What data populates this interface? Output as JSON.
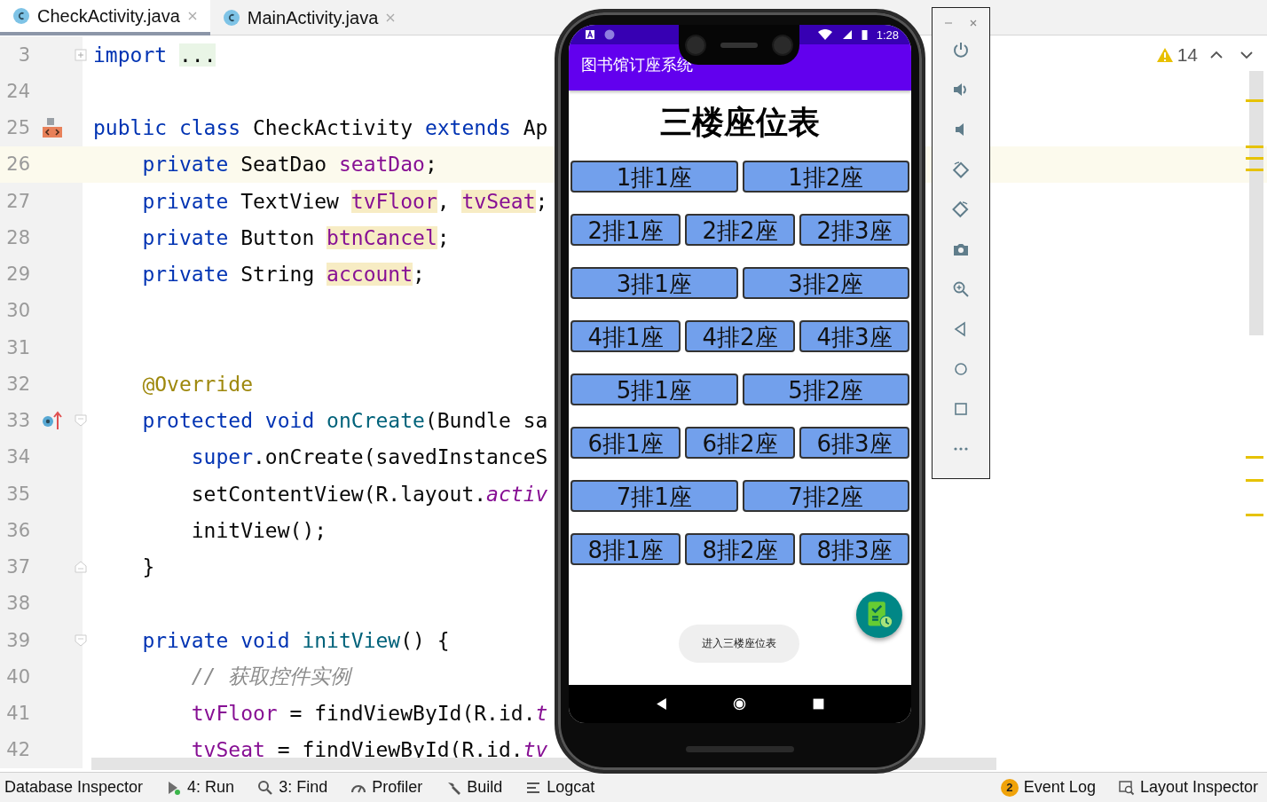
{
  "tabs": [
    {
      "label": "CheckActivity.java",
      "selected": true
    },
    {
      "label": "MainActivity.java",
      "selected": false
    }
  ],
  "editor": {
    "warning_count": "14",
    "lines": [
      {
        "number": "3",
        "current": false,
        "tokens": [
          {
            "text": "import ",
            "kind": "kw"
          },
          {
            "text": "...",
            "kind": "folded"
          }
        ]
      },
      {
        "number": "24",
        "current": false
      },
      {
        "number": "25",
        "current": false,
        "tokens": [
          {
            "text": "public class",
            "kind": "kw"
          },
          {
            "text": " CheckActivity ",
            "kind": "plain"
          },
          {
            "text": "extends",
            "kind": "kw"
          },
          {
            "text": " Ap",
            "kind": "plain"
          }
        ]
      },
      {
        "number": "26",
        "current": true,
        "tokens": [
          {
            "text": "    private",
            "kind": "kw"
          },
          {
            "text": " SeatDao ",
            "kind": "plain"
          },
          {
            "text": "seatDao",
            "kind": "field"
          },
          {
            "text": ";",
            "kind": "plain"
          }
        ]
      },
      {
        "number": "27",
        "current": false,
        "tokens": [
          {
            "text": "    private",
            "kind": "kw"
          },
          {
            "text": " TextView ",
            "kind": "plain"
          },
          {
            "text": "tvFloor",
            "kind": "marked_field"
          },
          {
            "text": ", ",
            "kind": "plain"
          },
          {
            "text": "tvSeat",
            "kind": "marked_field"
          },
          {
            "text": ";",
            "kind": "plain"
          }
        ]
      },
      {
        "number": "28",
        "current": false,
        "tokens": [
          {
            "text": "    private",
            "kind": "kw"
          },
          {
            "text": " Button ",
            "kind": "plain"
          },
          {
            "text": "btnCancel",
            "kind": "marked_field"
          },
          {
            "text": ";",
            "kind": "plain"
          }
        ]
      },
      {
        "number": "29",
        "current": false,
        "tokens": [
          {
            "text": "    private",
            "kind": "kw"
          },
          {
            "text": " String ",
            "kind": "plain"
          },
          {
            "text": "account",
            "kind": "marked_field"
          },
          {
            "text": ";",
            "kind": "plain"
          }
        ]
      },
      {
        "number": "30",
        "current": false
      },
      {
        "number": "31",
        "current": false
      },
      {
        "number": "32",
        "current": false,
        "tokens": [
          {
            "text": "    @Override",
            "kind": "annotation"
          }
        ]
      },
      {
        "number": "33",
        "current": false,
        "tokens": [
          {
            "text": "    protected void",
            "kind": "kw"
          },
          {
            "text": " onCreate",
            "kind": "method"
          },
          {
            "text": "(Bundle sa",
            "kind": "plain"
          }
        ]
      },
      {
        "number": "34",
        "current": false,
        "tokens": [
          {
            "text": "        super",
            "kind": "kw"
          },
          {
            "text": ".onCreate(savedInstanceS",
            "kind": "plain"
          }
        ]
      },
      {
        "number": "35",
        "current": false,
        "tokens": [
          {
            "text": "        setContentView(R.layout.",
            "kind": "plain"
          },
          {
            "text": "activ",
            "kind": "static"
          }
        ]
      },
      {
        "number": "36",
        "current": false,
        "tokens": [
          {
            "text": "        initView();",
            "kind": "plain"
          }
        ]
      },
      {
        "number": "37",
        "current": false,
        "tokens": [
          {
            "text": "    }",
            "kind": "plain"
          }
        ]
      },
      {
        "number": "38",
        "current": false
      },
      {
        "number": "39",
        "current": false,
        "tokens": [
          {
            "text": "    private void",
            "kind": "kw"
          },
          {
            "text": " initView",
            "kind": "method"
          },
          {
            "text": "() {",
            "kind": "plain"
          }
        ]
      },
      {
        "number": "40",
        "current": false,
        "tokens": [
          {
            "text": "        // 获取控件实例",
            "kind": "comment"
          }
        ]
      },
      {
        "number": "41",
        "current": false,
        "tokens": [
          {
            "text": "        tvFloor",
            "kind": "field"
          },
          {
            "text": " = findViewById(R.id.",
            "kind": "plain"
          },
          {
            "text": "t",
            "kind": "static"
          }
        ]
      },
      {
        "number": "42",
        "current": false,
        "tokens": [
          {
            "text": "        tvSeat",
            "kind": "field"
          },
          {
            "text": " = findViewById(R.id.",
            "kind": "plain"
          },
          {
            "text": "tv",
            "kind": "static"
          }
        ]
      }
    ]
  },
  "emulator": {
    "status_time": "1:28",
    "app_title": "图书馆订座系统",
    "heading": "三楼座位表",
    "seat_rows": [
      {
        "seats": [
          "1排1座",
          "1排2座"
        ]
      },
      {
        "seats": [
          "2排1座",
          "2排2座",
          "2排3座"
        ]
      },
      {
        "seats": [
          "3排1座",
          "3排2座"
        ]
      },
      {
        "seats": [
          "4排1座",
          "4排2座",
          "4排3座"
        ]
      },
      {
        "seats": [
          "5排1座",
          "5排2座"
        ]
      },
      {
        "seats": [
          "6排1座",
          "6排2座",
          "6排3座"
        ]
      },
      {
        "seats": [
          "7排1座",
          "7排2座"
        ]
      },
      {
        "seats": [
          "8排1座",
          "8排2座",
          "8排3座"
        ]
      }
    ],
    "toast": "进入三楼座位表"
  },
  "tool_window_bar": {
    "left_items": [
      {
        "label": "Database Inspector"
      },
      {
        "label": "4: Run"
      },
      {
        "label": "3: Find"
      },
      {
        "label": "Profiler"
      },
      {
        "label": "Build"
      },
      {
        "label": "Logcat"
      }
    ],
    "right_items": [
      {
        "label": "Event Log",
        "badge": "2"
      },
      {
        "label": "Layout Inspector"
      }
    ]
  }
}
